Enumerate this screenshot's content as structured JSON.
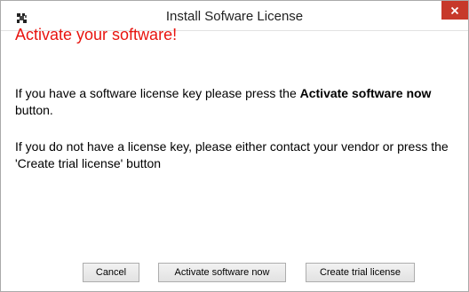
{
  "window": {
    "title": "Install Sofware License",
    "app_icon": "app-icon",
    "close_icon": "close-icon",
    "close_color": "#c7392a"
  },
  "body": {
    "heading": "Activate your software!",
    "heading_color": "#e8140f",
    "para1_prefix": "If you have a software license key please press the ",
    "para1_bold": "Activate software now",
    "para1_suffix": " button.",
    "para2": "If you do not have a license key, please either contact your vendor or press the 'Create trial license' button"
  },
  "buttons": {
    "cancel": "Cancel",
    "activate": "Activate software now",
    "trial": "Create trial license"
  }
}
